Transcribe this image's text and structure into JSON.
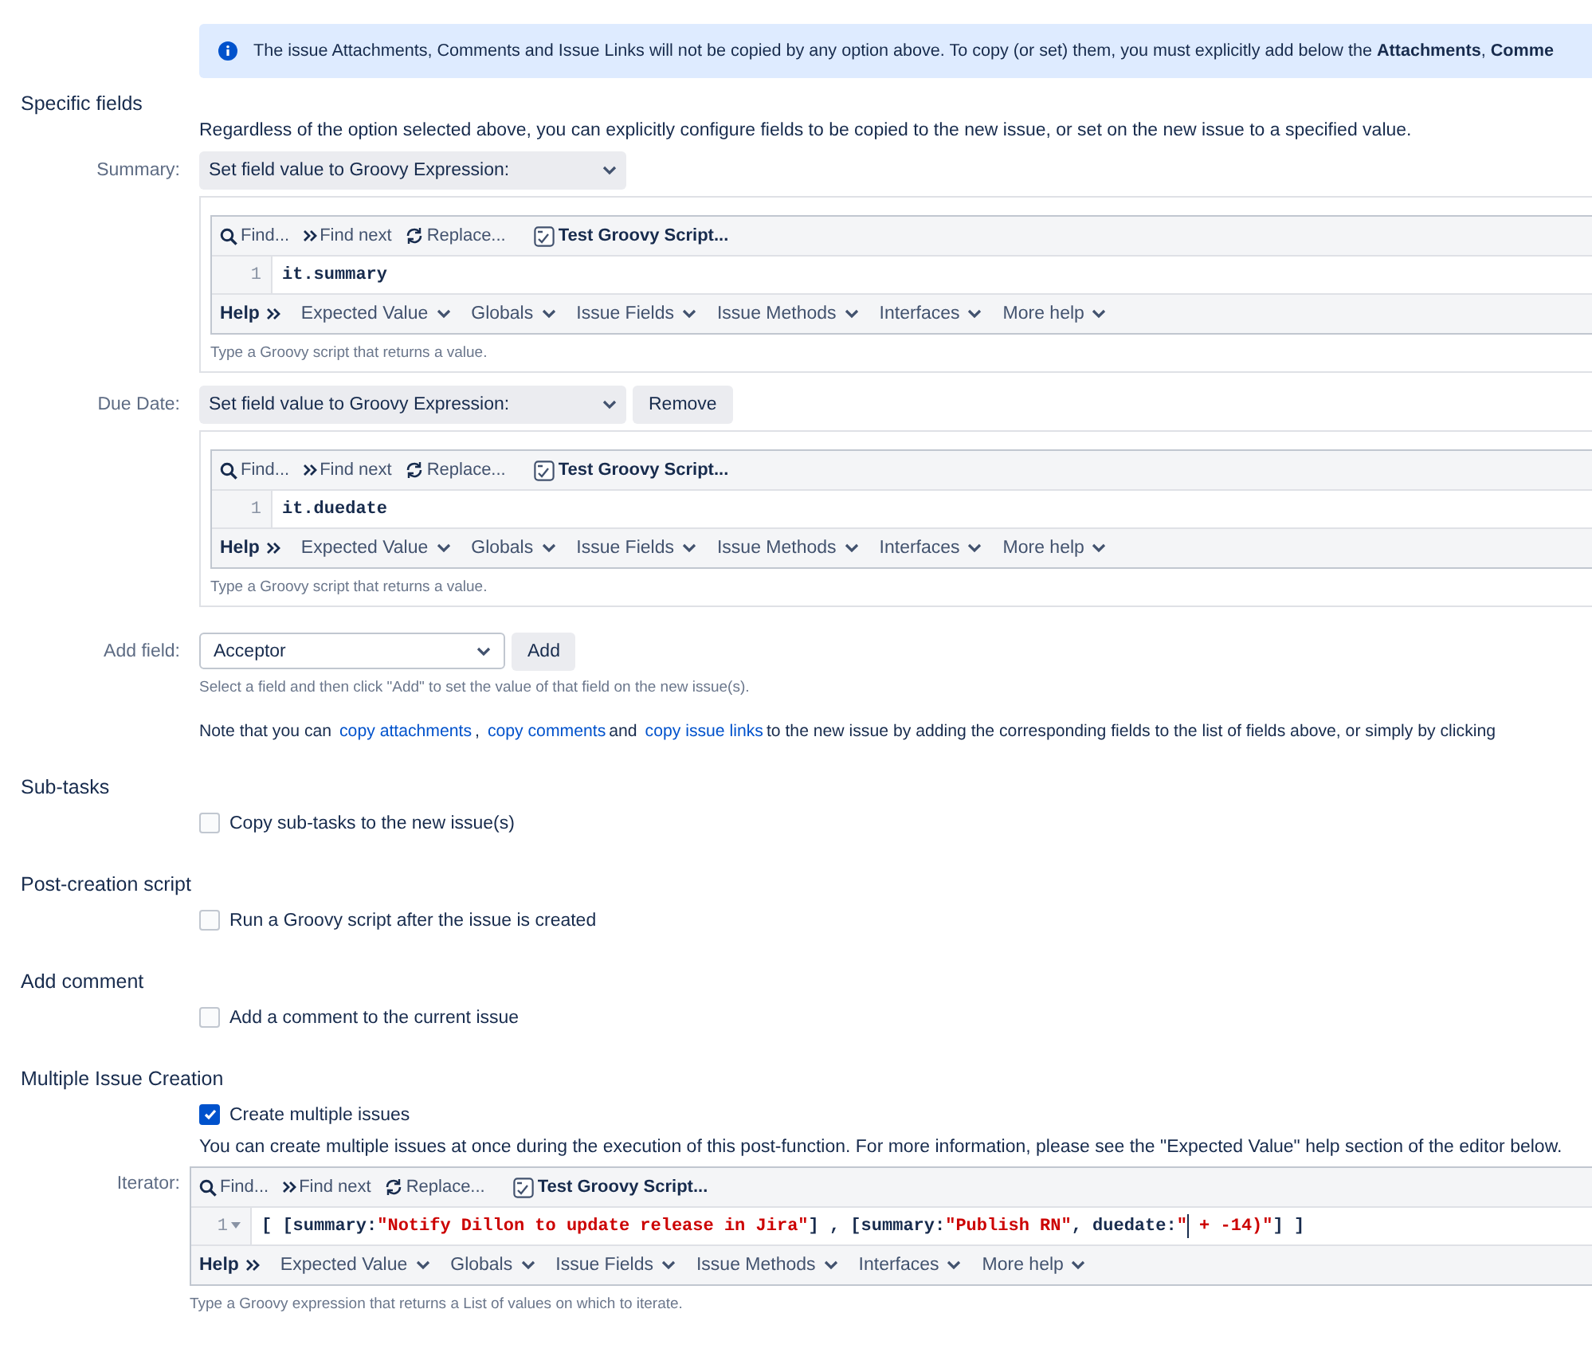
{
  "notice": {
    "text": "The issue Attachments, Comments and Issue Links will not be copied by any option above. To copy (or set) them, you must explicitly add below the **Attachments**, **Comme**"
  },
  "specific_fields": {
    "heading": "Specific fields",
    "description": "Regardless of the option selected above, you can explicitly configure fields to be copied to the new issue, or set on the new issue to a specified value.",
    "fields": [
      {
        "label": "Summary:",
        "select": "Set field value to Groovy Expression:",
        "editor": {
          "toolbar": [
            {
              "kind": "find",
              "text": "Find..."
            },
            {
              "kind": "find-next",
              "text": "Find next"
            },
            {
              "kind": "replace",
              "text": "Replace..."
            },
            {
              "kind": "test",
              "text": "Test Groovy Script..."
            }
          ],
          "lines": [
            {
              "number": "1",
              "foldable": false,
              "tokens": [
                {
                  "kind": "plain",
                  "text": "it.summary"
                }
              ]
            }
          ],
          "help_label": "Help",
          "help_menus": [
            "Expected Value",
            "Globals",
            "Issue Fields",
            "Issue Methods",
            "Interfaces",
            "More help"
          ],
          "hint": "Type a Groovy script that returns a value."
        }
      },
      {
        "label": "Due Date:",
        "select": "Set field value to Groovy Expression:",
        "remove_button": "Remove",
        "editor": {
          "toolbar": [
            {
              "kind": "find",
              "text": "Find..."
            },
            {
              "kind": "find-next",
              "text": "Find next"
            },
            {
              "kind": "replace",
              "text": "Replace..."
            },
            {
              "kind": "test",
              "text": "Test Groovy Script..."
            }
          ],
          "lines": [
            {
              "number": "1",
              "foldable": false,
              "tokens": [
                {
                  "kind": "plain",
                  "text": "it.duedate"
                }
              ]
            }
          ],
          "help_label": "Help",
          "help_menus": [
            "Expected Value",
            "Globals",
            "Issue Fields",
            "Issue Methods",
            "Interfaces",
            "More help"
          ],
          "hint": "Type a Groovy script that returns a value."
        }
      }
    ],
    "add_field": {
      "label": "Add field:",
      "select": "Acceptor",
      "button": "Add",
      "hint": "Select a field and then click \"Add\" to set the value of that field on the new issue(s)."
    },
    "note": [
      {
        "kind": "text",
        "text": "Note that you can"
      },
      {
        "kind": "link",
        "text": "copy attachments"
      },
      {
        "kind": "text",
        "text": ","
      },
      {
        "kind": "link",
        "text": "copy comments"
      },
      {
        "kind": "text",
        "text": "and"
      },
      {
        "kind": "link",
        "text": "copy issue links"
      },
      {
        "kind": "text",
        "text": "to the new issue by adding the corresponding fields to the list of fields above, or simply by clicking"
      }
    ]
  },
  "sections": [
    {
      "heading": "Sub-tasks",
      "checkbox": {
        "label": "Copy sub-tasks to the new issue(s)",
        "checked": false
      }
    },
    {
      "heading": "Post-creation script",
      "checkbox": {
        "label": "Run a Groovy script after the issue is created",
        "checked": false
      }
    },
    {
      "heading": "Add comment",
      "checkbox": {
        "label": "Add a comment to the current issue",
        "checked": false
      }
    },
    {
      "heading": "Multiple Issue Creation",
      "checkbox": {
        "label": "Create multiple issues",
        "checked": true
      },
      "description": "You can create multiple issues at once during the execution of this post-function. For more information, please see the \"Expected Value\" help section of the editor below.",
      "iterator": {
        "label": "Iterator:",
        "editor": {
          "toolbar": [
            {
              "kind": "find",
              "text": "Find..."
            },
            {
              "kind": "find-next",
              "text": "Find next"
            },
            {
              "kind": "replace",
              "text": "Replace..."
            },
            {
              "kind": "test",
              "text": "Test Groovy Script..."
            }
          ],
          "lines": [
            {
              "number": "1",
              "foldable": true,
              "tokens": [
                {
                  "kind": "plain",
                  "text": "[ [summary:"
                },
                {
                  "kind": "string",
                  "text": "\"Notify Dillon to update release in Jira\""
                },
                {
                  "kind": "plain",
                  "text": "] , [summary:"
                },
                {
                  "kind": "string",
                  "text": "\"Publish RN\""
                },
                {
                  "kind": "plain",
                  "text": ", duedate:"
                },
                {
                  "kind": "string",
                  "text": "\""
                },
                {
                  "kind": "cursor"
                },
                {
                  "kind": "string",
                  "text": " + -14)\""
                },
                {
                  "kind": "plain",
                  "text": "] ]"
                }
              ]
            }
          ],
          "help_label": "Help",
          "help_menus": [
            "Expected Value",
            "Globals",
            "Issue Fields",
            "Issue Methods",
            "Interfaces",
            "More help"
          ],
          "hint": "Type a Groovy expression that returns a List of values on which to iterate."
        }
      }
    }
  ]
}
